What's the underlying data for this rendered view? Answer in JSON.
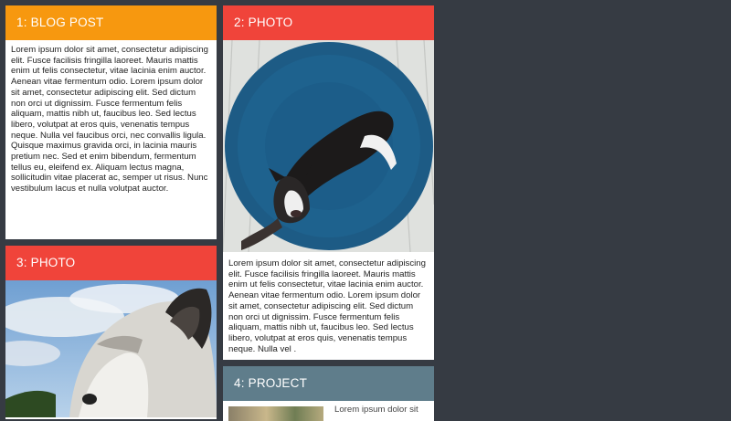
{
  "colors": {
    "background": "#363b43",
    "blog_header": "#f7980f",
    "photo_header": "#f0443a",
    "project_header": "#5f7d8b"
  },
  "cards": [
    {
      "title": "1: BLOG POST",
      "body": "Lorem ipsum dolor sit amet, consectetur adipiscing elit. Fusce facilisis fringilla laoreet. Mauris mattis enim ut felis consectetur, vitae lacinia enim auctor. Aenean vitae fermentum odio. Lorem ipsum dolor sit amet, consectetur adipiscing elit. Sed dictum non orci ut dignissim. Fusce fermentum felis aliquam, mattis nibh ut, faucibus leo. Sed lectus libero, volutpat at eros quis, venenatis tempus neque. Nulla vel faucibus orci, nec convallis ligula. Quisque maximus gravida orci, in lacinia mauris pretium nec. Sed et enim bibendum, fermentum tellus eu, eleifend ex. Aliquam lectus magna, sollicitudin vitae placerat ac, semper ut risus. Nunc vestibulum lacus et nulla volutpat auctor."
    },
    {
      "title": "2: PHOTO",
      "body": "Lorem ipsum dolor sit amet, consectetur adipiscing elit. Fusce facilisis fringilla laoreet. Mauris mattis enim ut felis consectetur, vitae lacinia enim auctor. Aenean vitae fermentum odio. Lorem ipsum dolor sit amet, consectetur adipiscing elit. Sed dictum non orci ut dignissim. Fusce fermentum felis aliquam, mattis nibh ut, faucibus leo. Sed lectus libero, volutpat at eros quis, venenatis tempus neque. Nulla vel ."
    },
    {
      "title": "3: PHOTO"
    },
    {
      "title": "4: PROJECT",
      "snippet": "Lorem ipsum dolor sit"
    }
  ]
}
